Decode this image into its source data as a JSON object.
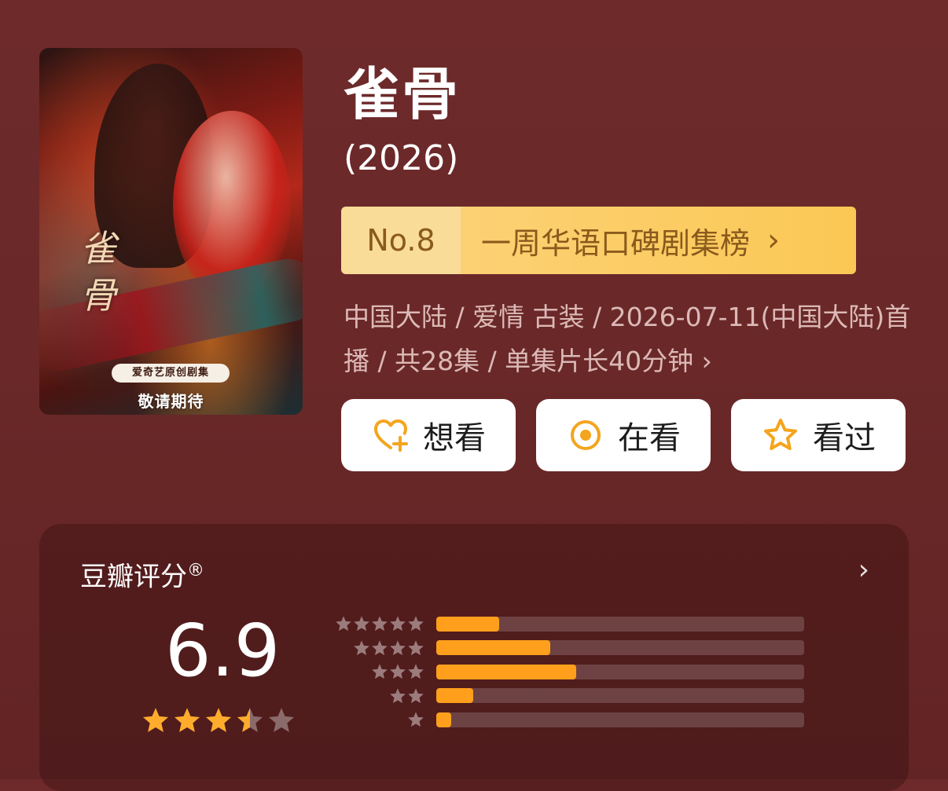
{
  "poster": {
    "title_calligraphy": "雀骨",
    "studio_tag": "爱奇艺原创剧集",
    "coming_soon": "敬请期待"
  },
  "show": {
    "title": "雀骨",
    "year": "(2026)"
  },
  "ranking": {
    "rank": "No.8",
    "list_name": "一周华语口碑剧集榜",
    "chevron": "›"
  },
  "meta": {
    "text": "中国大陆 / 爱情 古装 / 2026-07-11(中国大陆)首播 / 共28集 / 单集片长40分钟 ›"
  },
  "actions": [
    {
      "label": "想看",
      "icon": "heart-plus-icon"
    },
    {
      "label": "在看",
      "icon": "target-circle-icon"
    },
    {
      "label": "看过",
      "icon": "star-outline-icon"
    }
  ],
  "rating": {
    "label": "豆瓣评分",
    "registered_mark": "®",
    "score": "6.9",
    "star_value": 3.5,
    "chevron": "›",
    "distribution": [
      {
        "stars": 5,
        "fraction": 0.17
      },
      {
        "stars": 4,
        "fraction": 0.31
      },
      {
        "stars": 3,
        "fraction": 0.38
      },
      {
        "stars": 2,
        "fraction": 0.1
      },
      {
        "stars": 1,
        "fraction": 0.04
      }
    ]
  },
  "colors": {
    "background": "#6a2828",
    "accent_orange": "#ff9f1c",
    "rank_gold": "#fcd174",
    "rank_text": "#8a5a1c",
    "star_gold": "#ffac2d",
    "star_gray": "#8a6a6a"
  }
}
